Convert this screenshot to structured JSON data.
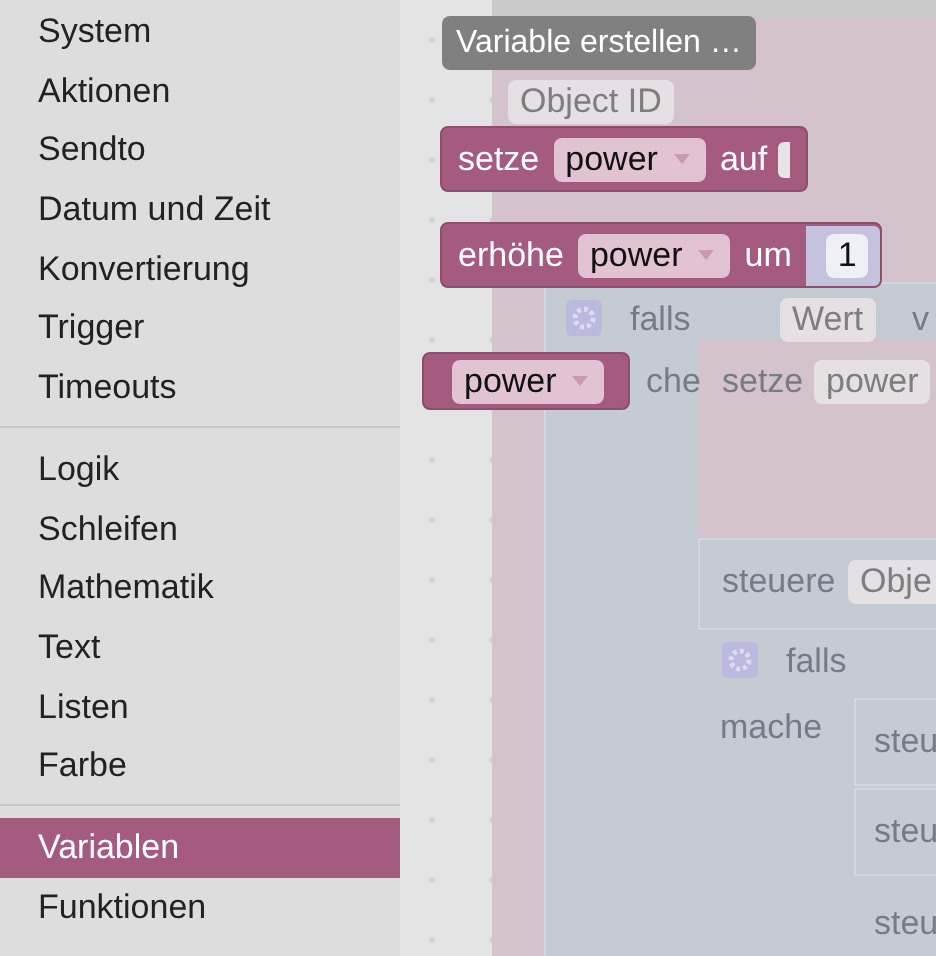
{
  "toolbox": {
    "groups": [
      {
        "items": [
          {
            "label": "System",
            "selected": false
          },
          {
            "label": "Aktionen",
            "selected": false
          },
          {
            "label": "Sendto",
            "selected": false
          },
          {
            "label": "Datum und Zeit",
            "selected": false
          },
          {
            "label": "Konvertierung",
            "selected": false
          },
          {
            "label": "Trigger",
            "selected": false
          },
          {
            "label": "Timeouts",
            "selected": false
          }
        ]
      },
      {
        "items": [
          {
            "label": "Logik",
            "selected": false
          },
          {
            "label": "Schleifen",
            "selected": false
          },
          {
            "label": "Mathematik",
            "selected": false
          },
          {
            "label": "Text",
            "selected": false
          },
          {
            "label": "Listen",
            "selected": false
          },
          {
            "label": "Farbe",
            "selected": false
          }
        ]
      },
      {
        "items": [
          {
            "label": "Variablen",
            "selected": true
          },
          {
            "label": "Funktionen",
            "selected": false
          }
        ]
      }
    ]
  },
  "flyout": {
    "create_button": "Variable erstellen …",
    "blocks": [
      {
        "kind": "set",
        "parts": [
          {
            "kind": "label",
            "text": "setze"
          },
          {
            "kind": "dropdown",
            "text": "power"
          },
          {
            "kind": "label",
            "text": "auf"
          }
        ]
      },
      {
        "kind": "set",
        "parts": [
          {
            "kind": "label",
            "text": "erhöhe"
          },
          {
            "kind": "dropdown",
            "text": "power"
          },
          {
            "kind": "label",
            "text": "um"
          },
          {
            "kind": "number",
            "text": "1"
          }
        ]
      },
      {
        "kind": "get",
        "parts": [
          {
            "kind": "dropdown",
            "text": "power"
          }
        ]
      }
    ]
  },
  "workspace": {
    "texts": [
      {
        "kind": "field",
        "text": "Object ID"
      },
      {
        "kind": "label",
        "text": "falls"
      },
      {
        "kind": "field",
        "text": "Wert"
      },
      {
        "kind": "label",
        "text": "v"
      },
      {
        "kind": "label",
        "text": "che"
      },
      {
        "kind": "label",
        "text": "setze"
      },
      {
        "kind": "field",
        "text": "power"
      },
      {
        "kind": "label",
        "text": "steuere"
      },
      {
        "kind": "field",
        "text": "Obje"
      },
      {
        "kind": "label",
        "text": "falls"
      },
      {
        "kind": "label",
        "text": "mache"
      },
      {
        "kind": "label",
        "text": "steu"
      },
      {
        "kind": "label",
        "text": "steu"
      },
      {
        "kind": "label",
        "text": "steu"
      }
    ]
  }
}
